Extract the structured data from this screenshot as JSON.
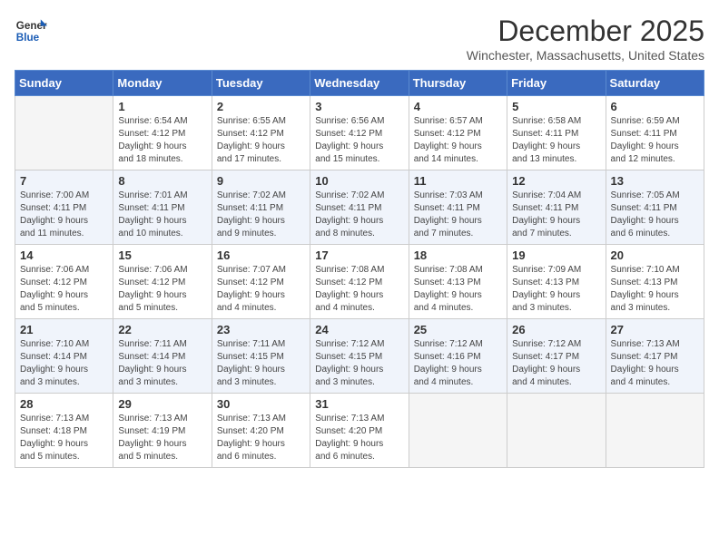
{
  "logo": {
    "line1": "General",
    "line2": "Blue"
  },
  "title": "December 2025",
  "location": "Winchester, Massachusetts, United States",
  "days_of_week": [
    "Sunday",
    "Monday",
    "Tuesday",
    "Wednesday",
    "Thursday",
    "Friday",
    "Saturday"
  ],
  "weeks": [
    [
      {
        "num": "",
        "info": ""
      },
      {
        "num": "1",
        "info": "Sunrise: 6:54 AM\nSunset: 4:12 PM\nDaylight: 9 hours\nand 18 minutes."
      },
      {
        "num": "2",
        "info": "Sunrise: 6:55 AM\nSunset: 4:12 PM\nDaylight: 9 hours\nand 17 minutes."
      },
      {
        "num": "3",
        "info": "Sunrise: 6:56 AM\nSunset: 4:12 PM\nDaylight: 9 hours\nand 15 minutes."
      },
      {
        "num": "4",
        "info": "Sunrise: 6:57 AM\nSunset: 4:12 PM\nDaylight: 9 hours\nand 14 minutes."
      },
      {
        "num": "5",
        "info": "Sunrise: 6:58 AM\nSunset: 4:11 PM\nDaylight: 9 hours\nand 13 minutes."
      },
      {
        "num": "6",
        "info": "Sunrise: 6:59 AM\nSunset: 4:11 PM\nDaylight: 9 hours\nand 12 minutes."
      }
    ],
    [
      {
        "num": "7",
        "info": "Sunrise: 7:00 AM\nSunset: 4:11 PM\nDaylight: 9 hours\nand 11 minutes."
      },
      {
        "num": "8",
        "info": "Sunrise: 7:01 AM\nSunset: 4:11 PM\nDaylight: 9 hours\nand 10 minutes."
      },
      {
        "num": "9",
        "info": "Sunrise: 7:02 AM\nSunset: 4:11 PM\nDaylight: 9 hours\nand 9 minutes."
      },
      {
        "num": "10",
        "info": "Sunrise: 7:02 AM\nSunset: 4:11 PM\nDaylight: 9 hours\nand 8 minutes."
      },
      {
        "num": "11",
        "info": "Sunrise: 7:03 AM\nSunset: 4:11 PM\nDaylight: 9 hours\nand 7 minutes."
      },
      {
        "num": "12",
        "info": "Sunrise: 7:04 AM\nSunset: 4:11 PM\nDaylight: 9 hours\nand 7 minutes."
      },
      {
        "num": "13",
        "info": "Sunrise: 7:05 AM\nSunset: 4:11 PM\nDaylight: 9 hours\nand 6 minutes."
      }
    ],
    [
      {
        "num": "14",
        "info": "Sunrise: 7:06 AM\nSunset: 4:12 PM\nDaylight: 9 hours\nand 5 minutes."
      },
      {
        "num": "15",
        "info": "Sunrise: 7:06 AM\nSunset: 4:12 PM\nDaylight: 9 hours\nand 5 minutes."
      },
      {
        "num": "16",
        "info": "Sunrise: 7:07 AM\nSunset: 4:12 PM\nDaylight: 9 hours\nand 4 minutes."
      },
      {
        "num": "17",
        "info": "Sunrise: 7:08 AM\nSunset: 4:12 PM\nDaylight: 9 hours\nand 4 minutes."
      },
      {
        "num": "18",
        "info": "Sunrise: 7:08 AM\nSunset: 4:13 PM\nDaylight: 9 hours\nand 4 minutes."
      },
      {
        "num": "19",
        "info": "Sunrise: 7:09 AM\nSunset: 4:13 PM\nDaylight: 9 hours\nand 3 minutes."
      },
      {
        "num": "20",
        "info": "Sunrise: 7:10 AM\nSunset: 4:13 PM\nDaylight: 9 hours\nand 3 minutes."
      }
    ],
    [
      {
        "num": "21",
        "info": "Sunrise: 7:10 AM\nSunset: 4:14 PM\nDaylight: 9 hours\nand 3 minutes."
      },
      {
        "num": "22",
        "info": "Sunrise: 7:11 AM\nSunset: 4:14 PM\nDaylight: 9 hours\nand 3 minutes."
      },
      {
        "num": "23",
        "info": "Sunrise: 7:11 AM\nSunset: 4:15 PM\nDaylight: 9 hours\nand 3 minutes."
      },
      {
        "num": "24",
        "info": "Sunrise: 7:12 AM\nSunset: 4:15 PM\nDaylight: 9 hours\nand 3 minutes."
      },
      {
        "num": "25",
        "info": "Sunrise: 7:12 AM\nSunset: 4:16 PM\nDaylight: 9 hours\nand 4 minutes."
      },
      {
        "num": "26",
        "info": "Sunrise: 7:12 AM\nSunset: 4:17 PM\nDaylight: 9 hours\nand 4 minutes."
      },
      {
        "num": "27",
        "info": "Sunrise: 7:13 AM\nSunset: 4:17 PM\nDaylight: 9 hours\nand 4 minutes."
      }
    ],
    [
      {
        "num": "28",
        "info": "Sunrise: 7:13 AM\nSunset: 4:18 PM\nDaylight: 9 hours\nand 5 minutes."
      },
      {
        "num": "29",
        "info": "Sunrise: 7:13 AM\nSunset: 4:19 PM\nDaylight: 9 hours\nand 5 minutes."
      },
      {
        "num": "30",
        "info": "Sunrise: 7:13 AM\nSunset: 4:20 PM\nDaylight: 9 hours\nand 6 minutes."
      },
      {
        "num": "31",
        "info": "Sunrise: 7:13 AM\nSunset: 4:20 PM\nDaylight: 9 hours\nand 6 minutes."
      },
      {
        "num": "",
        "info": ""
      },
      {
        "num": "",
        "info": ""
      },
      {
        "num": "",
        "info": ""
      }
    ]
  ]
}
